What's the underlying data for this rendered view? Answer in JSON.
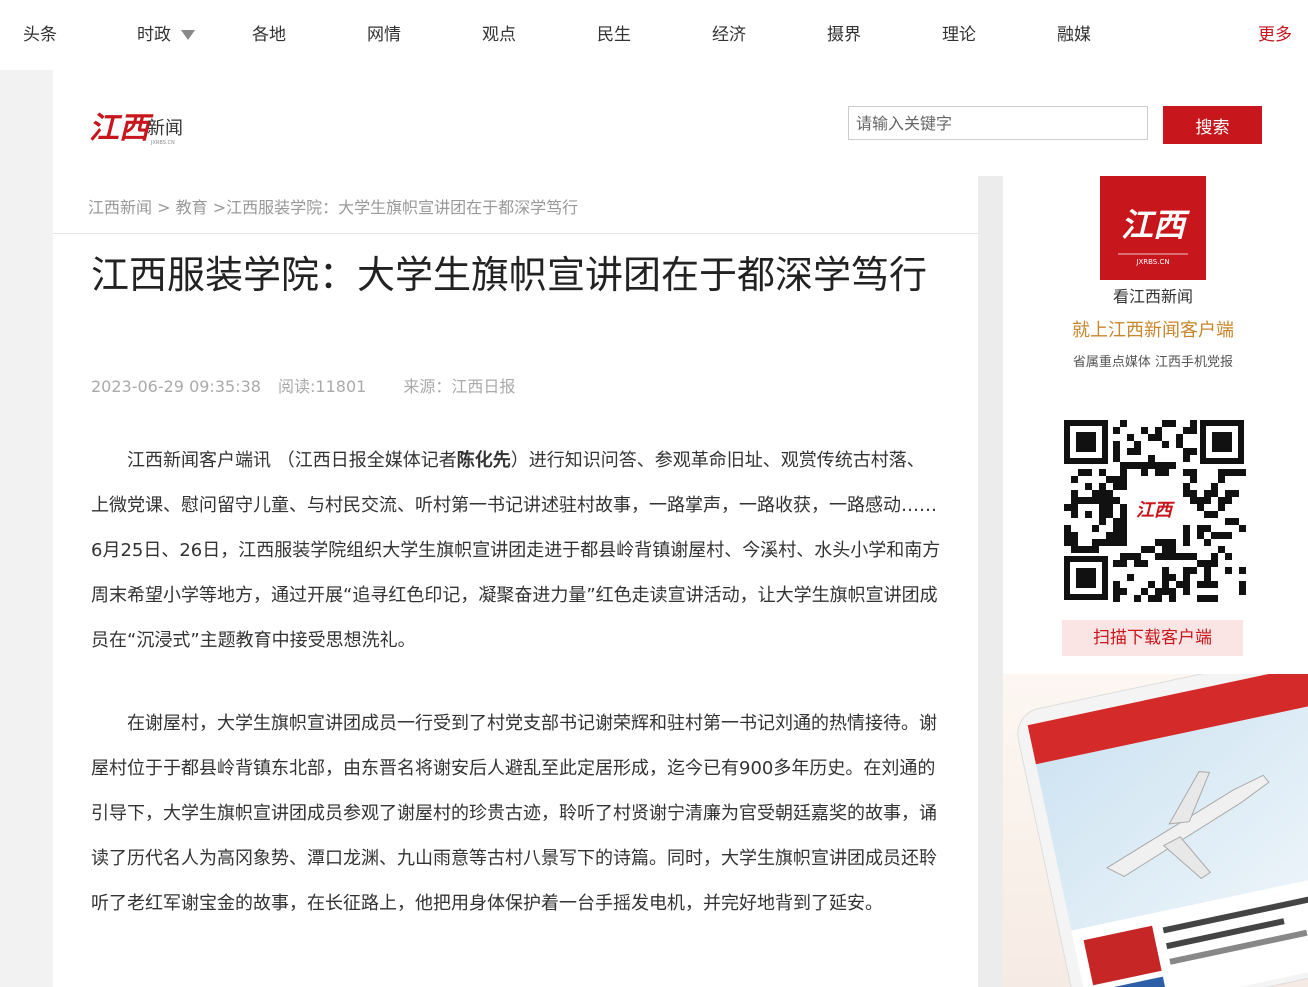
{
  "nav": {
    "items": [
      "头条",
      "时政",
      "各地",
      "网情",
      "观点",
      "民生",
      "经济",
      "摄界",
      "理论",
      "融媒"
    ],
    "more": "更多"
  },
  "logo": {
    "text": "江西新闻"
  },
  "search": {
    "placeholder": "请输入关键字",
    "button": "搜索"
  },
  "breadcrumb": {
    "home": "江西新闻",
    "sep": " > ",
    "category": "教育",
    "current": " >江西服装学院：大学生旗帜宣讲团在于都深学笃行"
  },
  "article": {
    "title": "江西服装学院：大学生旗帜宣讲团在于都深学笃行",
    "date": "2023-06-29 09:35:38",
    "reads": "阅读:11801",
    "source": "来源：江西日报",
    "p1_pre": "江西新闻客户端讯 （江西日报全媒体记者",
    "p1_author": "陈化先",
    "p1_post": "）进行知识问答、参观革命旧址、观赏传统古村落、上微党课、慰问留守儿童、与村民交流、听村第一书记讲述驻村故事，一路掌声，一路收获，一路感动……6月25日、26日，江西服装学院组织大学生旗帜宣讲团走进于都县岭背镇谢屋村、今溪村、水头小学和南方周末希望小学等地方，通过开展“追寻红色印记，凝聚奋进力量”红色走读宣讲活动，让大学生旗帜宣讲团成员在“沉浸式”主题教育中接受思想洗礼。",
    "p2": "在谢屋村，大学生旗帜宣讲团成员一行受到了村党支部书记谢荣辉和驻村第一书记刘通的热情接待。谢屋村位于于都县岭背镇东北部，由东晋名将谢安后人避乱至此定居形成，迄今已有900多年历史。在刘通的引导下，大学生旗帜宣讲团成员参观了谢屋村的珍贵古迹，聆听了村贤谢宁清廉为官受朝廷嘉奖的故事，诵读了历代名人为高冈象势、潭口龙渊、九山雨意等古村八景写下的诗篇。同时，大学生旗帜宣讲团成员还聆听了老红军谢宝金的故事，在长征路上，他把用身体保护着一台手摇发电机，并完好地背到了延安。"
  },
  "sidebar": {
    "app_logo_text": "江西",
    "app_logo_sub": "JXRBS.CN",
    "line1": "看江西新闻",
    "line2": "就上江西新闻客户端",
    "line3": "省属重点媒体 江西手机党报",
    "download": "扫描下载客户端"
  },
  "colors": {
    "brand": "#c8161d",
    "accent": "#c8862d",
    "text": "#333333"
  },
  "icons": {
    "dropdown": "triangle-down-icon",
    "qr": "qr-code-icon"
  }
}
